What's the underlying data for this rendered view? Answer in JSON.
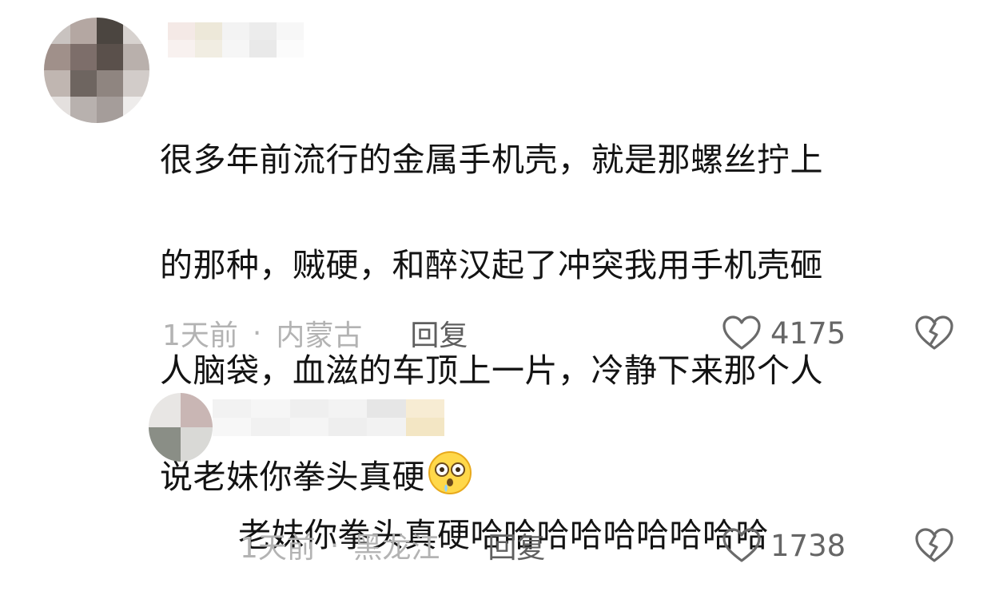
{
  "comments": [
    {
      "text_lines": [
        "很多年前流行的金属手机壳，就是那螺丝拧上",
        "的那种，贼硬，和醉汉起了冲突我用手机壳砸",
        "人脑袋，血滋的车顶上一片，冷静下来那个人",
        "说老妹你拳头真硬"
      ],
      "emoji": "astonished-drooling-face-icon",
      "time": "1天前",
      "separator": "·",
      "location": "内蒙古",
      "reply_label": "回复",
      "like_count": "4175",
      "like_icon": "heart-outline-icon",
      "dislike_icon": "broken-heart-outline-icon"
    },
    {
      "text": "老妹你拳头真硬哈哈哈哈哈哈哈哈哈",
      "time": "1天前",
      "separator": "·",
      "location": "黑龙江",
      "reply_label": "回复",
      "like_count": "1738",
      "like_icon": "heart-outline-icon",
      "dislike_icon": "broken-heart-outline-icon"
    }
  ],
  "colors": {
    "text": "#131313",
    "meta": "#b3b3b3",
    "reply": "#5f5f5f",
    "icon": "#6a6a6a"
  }
}
